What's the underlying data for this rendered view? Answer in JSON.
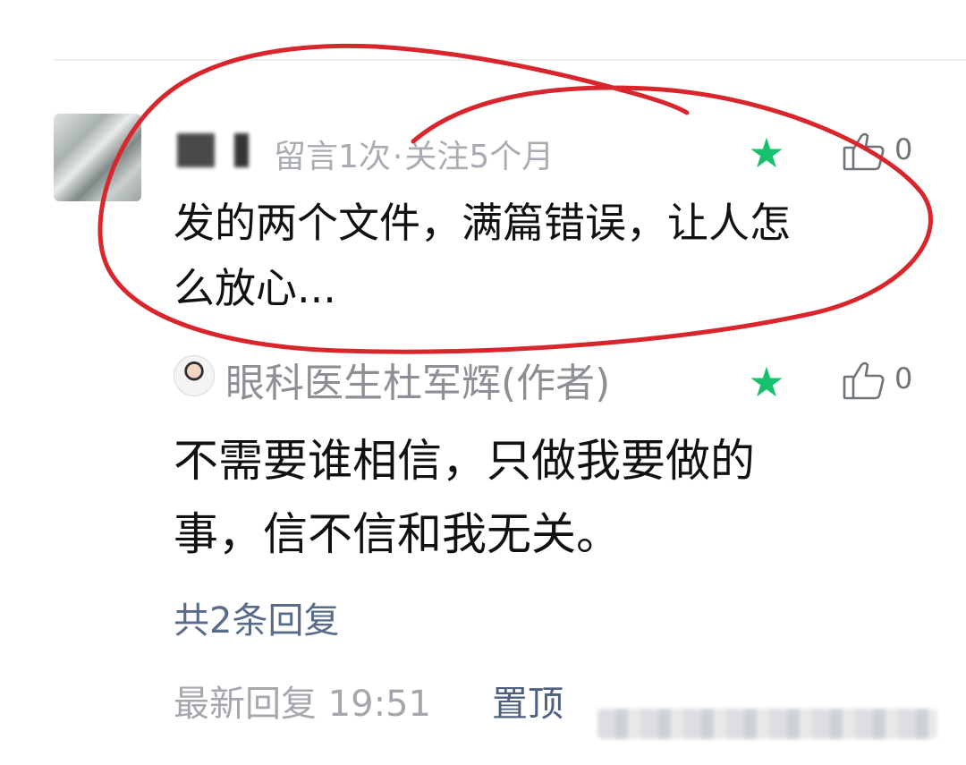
{
  "comment": {
    "meta_leave_count": "留言1次",
    "meta_separator": "·",
    "meta_follow": "关注5个月",
    "like_count": "0",
    "text_line1": "发的两个文件，满篇错误，让人怎",
    "text_line2": "么放心..."
  },
  "reply": {
    "author": "眼科医生杜军辉(作者)",
    "like_count": "0",
    "text_line1": "不需要谁相信，只做我要做的",
    "text_line2": "事，信不信和我无关。"
  },
  "replies_count_label": "共2条回复",
  "footer": {
    "latest_reply_label": "最新回复 19:51",
    "pin_label": "置顶"
  },
  "colors": {
    "star": "#16c16b",
    "annotation_circle": "#d8262c",
    "link": "#5a6b8a"
  },
  "icons": {
    "star": "star-icon",
    "like": "thumbs-up-icon"
  }
}
